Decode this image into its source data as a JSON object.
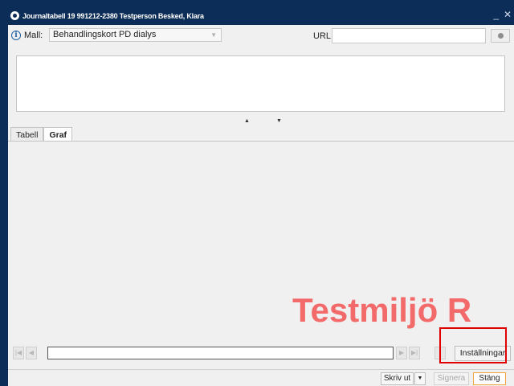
{
  "window": {
    "title": "Journaltabell 19 991212-2380 Testperson Besked, Klara",
    "minimize_glyph": "_",
    "close_glyph": "✕"
  },
  "toolbar": {
    "info_icon_glyph": "i",
    "mall_label": "Mall:",
    "mall_value": "Behandlingskort PD dialys",
    "url_label": "URL:",
    "url_value": ""
  },
  "splitter": {
    "up_glyph": "▲",
    "down_glyph": "▼"
  },
  "tabs": [
    {
      "label": "Tabell",
      "active": false
    },
    {
      "label": "Graf",
      "active": true
    }
  ],
  "watermark": {
    "text": "Testmiljö R"
  },
  "navigation": {
    "first_glyph": "|◀",
    "prev_glyph": "◀",
    "next_glyph": "▶",
    "last_glyph": "▶|",
    "edit_glyph": "/",
    "settings_label": "Inställningar"
  },
  "bottom": {
    "print_label": "Skriv ut",
    "print_drop_glyph": "▼",
    "sign_label": "Signera",
    "close_label": "Stäng"
  },
  "colors": {
    "titlebar": "#0c2d57",
    "watermark": "#f36a6a",
    "highlight": "#e00000",
    "close_border": "#f2a33a"
  },
  "icons": [
    "app-logo-icon",
    "info-icon",
    "go-icon",
    "first-page-icon",
    "prev-page-icon",
    "next-page-icon",
    "last-page-icon",
    "edit-icon",
    "dropdown-arrow-icon"
  ]
}
